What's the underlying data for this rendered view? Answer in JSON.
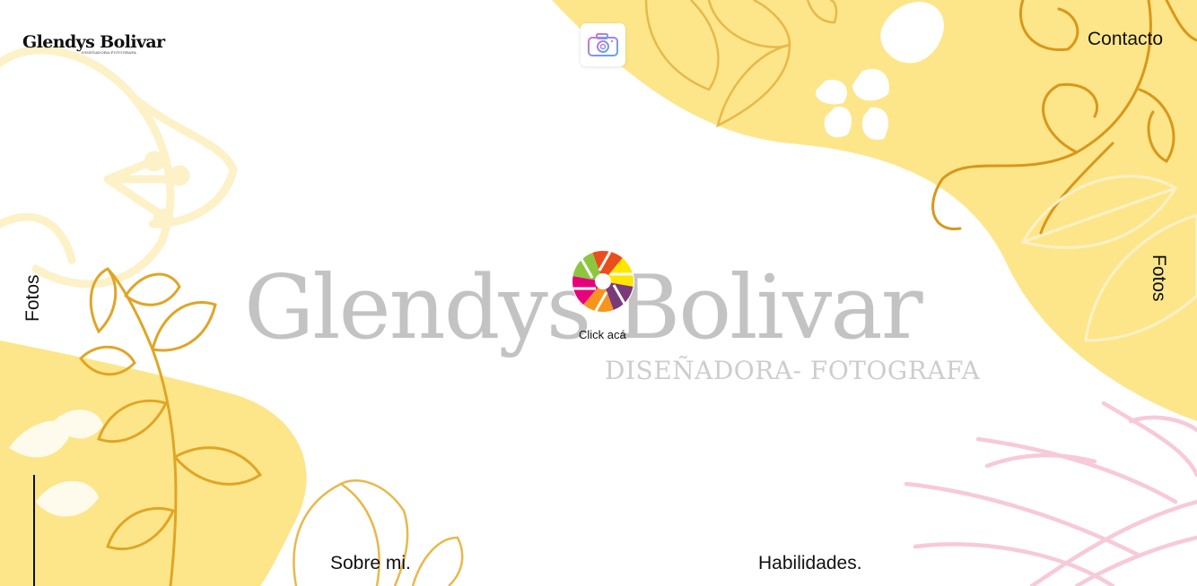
{
  "brand": {
    "small_name": "Glendys Bolivar",
    "small_sub": "DISEÑADORA-FOTOGRAFA",
    "big_name": "Glendys Bolivar",
    "big_sub": "DISEÑADORA- FOTOGRAFA"
  },
  "nav": {
    "contacto": "Contacto",
    "fotos_left": "Fotos",
    "fotos_right": "Fotos",
    "sobre": "Sobre mi.",
    "habilidades": "Habilidades."
  },
  "center": {
    "click_label": "Click acá"
  },
  "colors": {
    "yellow": "#fde68a",
    "gold": "#e0a526",
    "pink": "#f7c9d9",
    "gray_logo": "#c3c3c3"
  },
  "icons": [
    "camera-icon",
    "aperture-logo-icon"
  ]
}
